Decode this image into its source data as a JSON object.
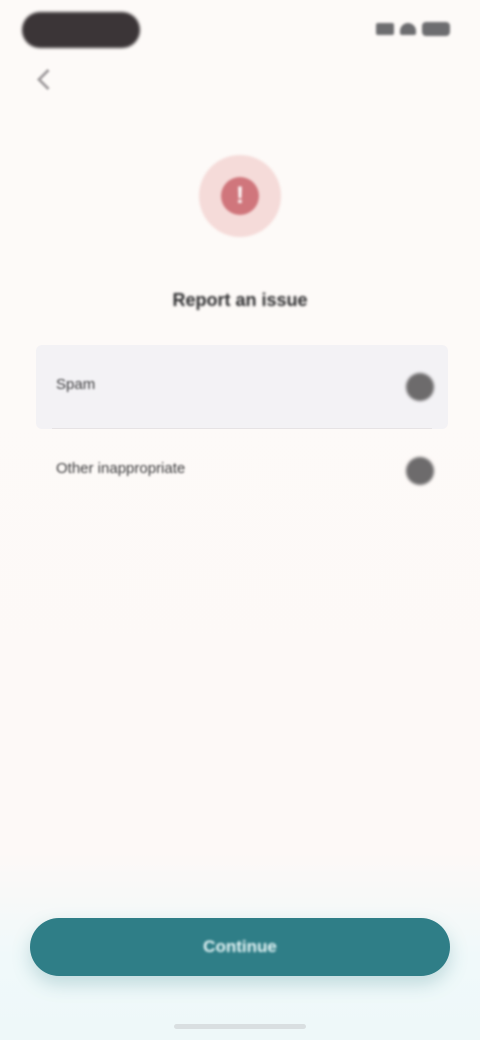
{
  "status_bar": {
    "icons": [
      "signal-icon",
      "wifi-icon",
      "battery-icon"
    ]
  },
  "header": {
    "back_icon": "chevron-left-icon"
  },
  "hero": {
    "icon": "alert-circle-icon",
    "icon_glyph": "!",
    "title": "Report an issue"
  },
  "list": {
    "items": [
      {
        "label": "Spam",
        "icon": "chevron-right-icon"
      },
      {
        "label": "Other inappropriate",
        "icon": "chevron-right-icon"
      }
    ]
  },
  "footer": {
    "primary_button_label": "Continue"
  },
  "colors": {
    "background": "#fdfaf8",
    "accent": "#2f7e87",
    "hero_icon": "#d0767c",
    "hero_icon_bg": "#f5dbd9"
  }
}
